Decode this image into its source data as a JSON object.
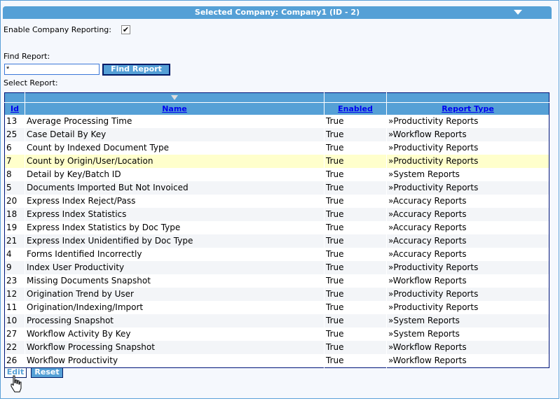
{
  "header": {
    "title": "Selected Company: Company1 (ID - 2)"
  },
  "enable_label": "Enable Company Reporting:",
  "enable_checked": true,
  "find_label": "Find Report:",
  "find_value": "*",
  "find_button": "Find Report",
  "select_label": "Select Report:",
  "columns": [
    "Id",
    "Name",
    "Enabled",
    "Report Type"
  ],
  "rows": [
    [
      "13",
      "Average Processing Time",
      "True",
      "»Productivity Reports"
    ],
    [
      "25",
      "Case Detail By Key",
      "True",
      "»Workflow Reports"
    ],
    [
      "6",
      "Count by Indexed Document Type",
      "True",
      "»Productivity Reports"
    ],
    [
      "7",
      "Count by Origin/User/Location",
      "True",
      "»Productivity Reports"
    ],
    [
      "8",
      "Detail by Key/Batch ID",
      "True",
      "»System Reports"
    ],
    [
      "5",
      "Documents Imported But Not Invoiced",
      "True",
      "»Productivity Reports"
    ],
    [
      "20",
      "Express Index Reject/Pass",
      "True",
      "»Accuracy Reports"
    ],
    [
      "18",
      "Express Index Statistics",
      "True",
      "»Accuracy Reports"
    ],
    [
      "19",
      "Express Index Statistics by Doc Type",
      "True",
      "»Accuracy Reports"
    ],
    [
      "21",
      "Express Index Unidentified by Doc Type",
      "True",
      "»Accuracy Reports"
    ],
    [
      "4",
      "Forms Identified Incorrectly",
      "True",
      "»Accuracy Reports"
    ],
    [
      "9",
      "Index User Productivity",
      "True",
      "»Productivity Reports"
    ],
    [
      "23",
      "Missing Documents Snapshot",
      "True",
      "»Workflow Reports"
    ],
    [
      "12",
      "Origination Trend by User",
      "True",
      "»Productivity Reports"
    ],
    [
      "11",
      "Origination/Indexing/Import",
      "True",
      "»Productivity Reports"
    ],
    [
      "10",
      "Processing Snapshot",
      "True",
      "»System Reports"
    ],
    [
      "27",
      "Workflow Activity By Key",
      "True",
      "»System Reports"
    ],
    [
      "22",
      "Workflow Processing Snapshot",
      "True",
      "»Workflow Reports"
    ],
    [
      "26",
      "Workflow Productivity",
      "True",
      "»Workflow Reports"
    ]
  ],
  "selected_row_index": 3,
  "edit_button": "Edit",
  "reset_button": "Reset"
}
